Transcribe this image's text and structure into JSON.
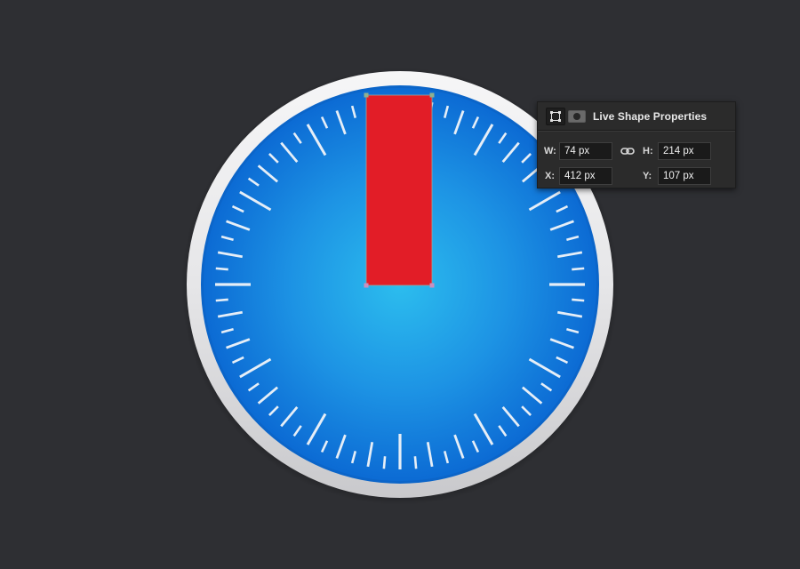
{
  "panel": {
    "title": "Live Shape Properties",
    "icons": [
      "transform-icon",
      "mask-icon",
      "link-icon"
    ],
    "fields": {
      "w_label": "W:",
      "w_value": "74 px",
      "h_label": "H:",
      "h_value": "214 px",
      "x_label": "X:",
      "x_value": "412 px",
      "y_label": "Y:",
      "y_value": "107 px"
    }
  },
  "colors": {
    "canvas_background": "#2e2f33",
    "bezel": "#e9e9ec",
    "dial_outer": "#0a6fd6",
    "dial_center": "#2bb8ec",
    "needle": "#e21d27",
    "ticks": "#e6eef7",
    "selection_handle": "#8fb08f"
  },
  "dial": {
    "tick_count": 72,
    "icon": "compass-dial-icon"
  }
}
